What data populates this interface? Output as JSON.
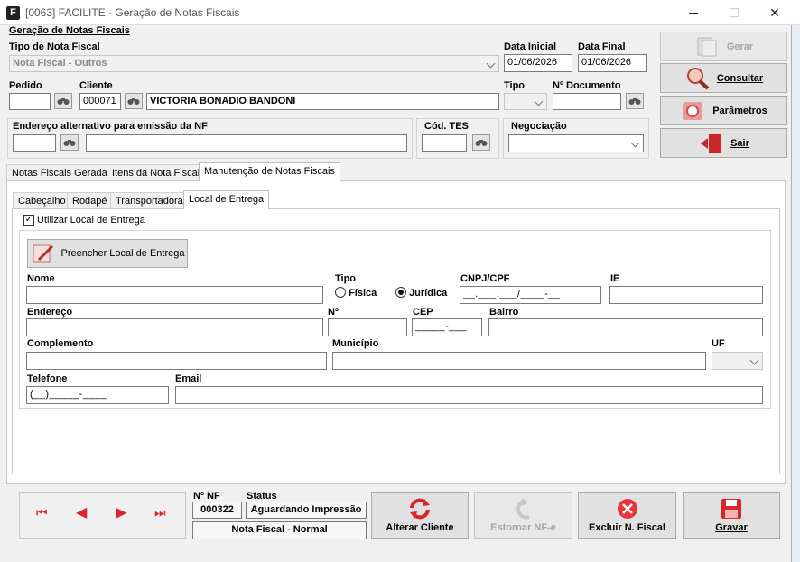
{
  "window": {
    "title": "[0063] FACILITE - Geração de Notas Fiscais"
  },
  "header": {
    "section_title": "Geração de Notas Fiscais"
  },
  "form": {
    "tipo_nf_label": "Tipo de Nota Fiscal",
    "tipo_nf_value": "Nota Fiscal - Outros",
    "data_inicial_label": "Data Inicial",
    "data_inicial_value": "01/06/2026",
    "data_final_label": "Data Final",
    "data_final_value": "01/06/2026",
    "pedido_label": "Pedido",
    "pedido_value": "",
    "cliente_label": "Cliente",
    "cliente_code": "000071",
    "cliente_name": "VICTORIA BONADIO BANDONI",
    "tipo_label": "Tipo",
    "nr_documento_label": "Nº Documento",
    "endereco_alt_label": "Endereço alternativo para emissão da NF",
    "cod_tes_label": "Cód. TES",
    "negociacao_label": "Negociação"
  },
  "side_buttons": {
    "gerar": "Gerar",
    "consultar": "Consultar",
    "parametros": "Parâmetros",
    "sair": "Sair"
  },
  "tabs": [
    "Notas Fiscais Geradas",
    "Itens da Nota Fiscal",
    "Manutenção de Notas Fiscais"
  ],
  "subtabs": [
    "Cabeçalho",
    "Rodapé",
    "Transportadora",
    "Local de Entrega"
  ],
  "entrega": {
    "checkbox_label": "Utilizar Local de Entrega",
    "preencher_button": "Preencher Local de Entrega",
    "nome_label": "Nome",
    "tipo_label": "Tipo",
    "fisica_label": "Física",
    "juridica_label": "Jurídica",
    "cnpj_label": "CNPJ/CPF",
    "cnpj_mask": "__.___.___/____-__",
    "ie_label": "IE",
    "endereco_label": "Endereço",
    "numero_label": "Nº",
    "cep_label": "CEP",
    "cep_mask": "_____-___",
    "bairro_label": "Bairro",
    "complemento_label": "Complemento",
    "municipio_label": "Município",
    "uf_label": "UF",
    "telefone_label": "Telefone",
    "telefone_mask": "(__)_____-____",
    "email_label": "Email"
  },
  "footer": {
    "nr_nf_label": "Nº NF",
    "nr_nf_value": "000322",
    "status_label": "Status",
    "status_value": "Aguardando Impressão",
    "nf_type": "Nota Fiscal - Normal",
    "alterar_cliente": "Alterar Cliente",
    "estornar": "Estornar NF-e",
    "excluir": "Excluir N. Fiscal",
    "gravar": "Gravar"
  },
  "colors": {
    "accent_red": "#d9262b",
    "title_text": "#444444"
  }
}
